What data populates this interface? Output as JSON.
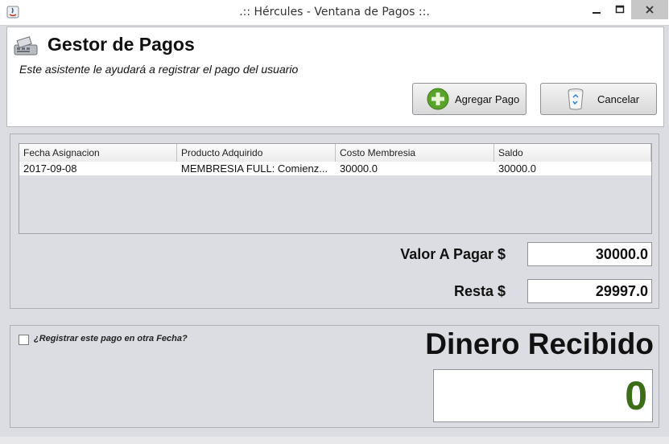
{
  "window": {
    "title": ".:: Hércules - Ventana de Pagos ::.",
    "min_icon": "minimize-icon",
    "max_icon": "maximize-icon",
    "close_icon": "close-icon"
  },
  "header": {
    "title": "Gestor de Pagos",
    "subtitle": "Este asistente le ayudará a registrar el pago del usuario",
    "add_button": "Agregar Pago",
    "cancel_button": "Cancelar"
  },
  "table": {
    "columns": [
      "Fecha Asignacion",
      "Producto Adquirido",
      "Costo Membresia",
      "Saldo"
    ],
    "rows": [
      [
        "2017-09-08",
        "MEMBRESIA FULL: Comienz...",
        "30000.0",
        "30000.0"
      ]
    ]
  },
  "fields": {
    "valor_label": "Valor A Pagar $",
    "valor_value": "30000.0",
    "resta_label": "Resta $",
    "resta_value": "29997.0"
  },
  "payment": {
    "checkbox_label": "¿Registrar este pago en otra Fecha?",
    "checkbox_checked": false,
    "title": "Dinero Recibido",
    "amount": "0",
    "amount_color": "#3c6e1a"
  }
}
